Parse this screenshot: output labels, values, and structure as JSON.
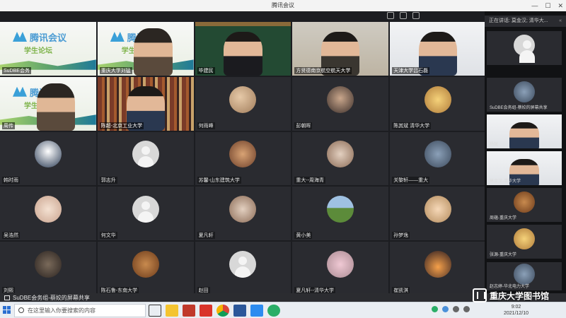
{
  "window": {
    "title": "腾讯会议"
  },
  "slide": {
    "title": "腾讯会议",
    "subtitle": "学生论坛"
  },
  "grid": [
    {
      "name": "SuDBE会务",
      "kind": "slide"
    },
    {
      "name": "重庆大学刘猛",
      "kind": "video-slide"
    },
    {
      "name": "毕建民",
      "kind": "board"
    },
    {
      "name": "方贤德南京航空航天大学",
      "kind": "room"
    },
    {
      "name": "天津大学吕石磊",
      "kind": "office"
    },
    {
      "name": "周传",
      "kind": "video-slide"
    },
    {
      "name": "陈超-北京工业大学",
      "kind": "bookshelf"
    },
    {
      "name": "何雨峰",
      "kind": "avatar",
      "avatar": "c1"
    },
    {
      "name": "彭朝晖",
      "kind": "avatar",
      "avatar": "c2"
    },
    {
      "name": "陈其斌 清华大学",
      "kind": "avatar",
      "avatar": "c3"
    },
    {
      "name": "韩时雨",
      "kind": "avatar",
      "avatar": "c4"
    },
    {
      "name": "郭志升",
      "kind": "avatar",
      "avatar": "gray"
    },
    {
      "name": "苏馨-山东建筑大学",
      "kind": "avatar",
      "avatar": "c5"
    },
    {
      "name": "重大--周海青",
      "kind": "avatar",
      "avatar": "c8"
    },
    {
      "name": "关黎轩——重大",
      "kind": "avatar",
      "avatar": "c6"
    },
    {
      "name": "吴浩然",
      "kind": "avatar",
      "avatar": "c7"
    },
    {
      "name": "何文华",
      "kind": "avatar",
      "avatar": "gray"
    },
    {
      "name": "夏凡轩",
      "kind": "avatar",
      "avatar": "c8"
    },
    {
      "name": "黄小美",
      "kind": "avatar",
      "avatar": "c9"
    },
    {
      "name": "孙梦逸",
      "kind": "avatar",
      "avatar": "c10"
    },
    {
      "name": "刘熙",
      "kind": "avatar",
      "avatar": "c11"
    },
    {
      "name": "陈石鲁-东南大学",
      "kind": "avatar",
      "avatar": "c12"
    },
    {
      "name": "赵田",
      "kind": "avatar",
      "avatar": "gray"
    },
    {
      "name": "夏凡轩--清华大学",
      "kind": "avatar",
      "avatar": "c13"
    },
    {
      "name": "崔凯淇",
      "kind": "avatar",
      "avatar": "c14"
    }
  ],
  "sidebar": {
    "speaking_label": "正在讲话: 莫金汉; 清华大...",
    "tiles": [
      {
        "name": "",
        "kind": "avatar",
        "avatar": "gray"
      },
      {
        "name": "SuDBE会务组-蔡姣的屏幕共享",
        "kind": "avatar",
        "avatar": "c6"
      },
      {
        "name": "杨斌",
        "kind": "office"
      },
      {
        "name": "莫金汉-清华大学",
        "kind": "office"
      },
      {
        "name": "周蕴-重庆大学",
        "kind": "avatar",
        "avatar": "c12"
      },
      {
        "name": "张源-重庆大学",
        "kind": "avatar",
        "avatar": "c3"
      },
      {
        "name": "赵志婷-华北电力大学",
        "kind": "avatar",
        "avatar": "c6"
      }
    ]
  },
  "share_bar": {
    "label": "SuDBE会务组-蔡姣的屏幕共享"
  },
  "taskbar": {
    "search_placeholder": "在这里输入你要搜索的内容",
    "time": "9:02",
    "date": "2021/12/10"
  },
  "watermark": {
    "text": "重庆大学图书馆"
  }
}
